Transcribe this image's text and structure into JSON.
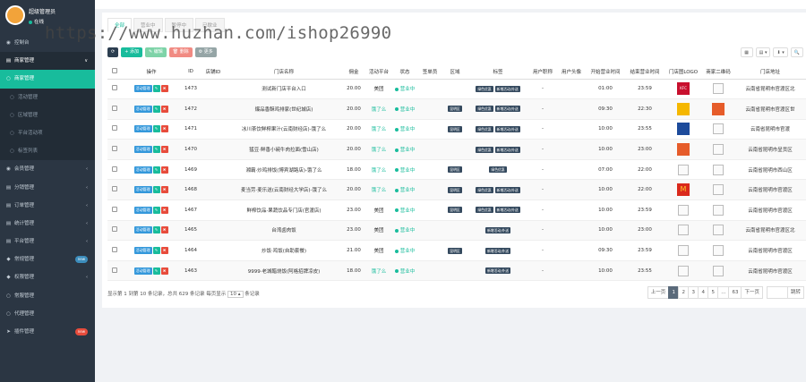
{
  "user": {
    "name": "超级管理员",
    "status": "在线"
  },
  "watermark": "https://www.huzhan.com/ishop26990",
  "topbar_hint": "",
  "sidebar": [
    {
      "icon": "◉",
      "label": "控制台",
      "type": "main",
      "badge": "",
      "arrow": ""
    },
    {
      "icon": "▤",
      "label": "商家管理",
      "type": "open",
      "badge": "",
      "arrow": "∨"
    },
    {
      "icon": "○",
      "label": "商家管理",
      "type": "active",
      "badge": "",
      "arrow": ""
    },
    {
      "icon": "○",
      "label": "活动管理",
      "type": "sub",
      "badge": "",
      "arrow": ""
    },
    {
      "icon": "○",
      "label": "区域管理",
      "type": "sub",
      "badge": "",
      "arrow": ""
    },
    {
      "icon": "○",
      "label": "平台活动项",
      "type": "sub",
      "badge": "",
      "arrow": ""
    },
    {
      "icon": "○",
      "label": "标签列表",
      "type": "sub",
      "badge": "",
      "arrow": ""
    },
    {
      "icon": "◉",
      "label": "会员管理",
      "type": "main",
      "badge": "",
      "arrow": "‹"
    },
    {
      "icon": "▤",
      "label": "分销管理",
      "type": "main",
      "badge": "",
      "arrow": "‹"
    },
    {
      "icon": "▤",
      "label": "订单管理",
      "type": "main",
      "badge": "",
      "arrow": "‹"
    },
    {
      "icon": "▤",
      "label": "统计管理",
      "type": "main",
      "badge": "",
      "arrow": "‹"
    },
    {
      "icon": "▤",
      "label": "平台管理",
      "type": "main",
      "badge": "",
      "arrow": "‹"
    },
    {
      "icon": "◆",
      "label": "常规管理",
      "type": "main",
      "badge": "new",
      "badgeColor": "#3c8dbc",
      "arrow": ""
    },
    {
      "icon": "◆",
      "label": "权限管理",
      "type": "main",
      "badge": "",
      "arrow": "‹"
    },
    {
      "icon": "○",
      "label": "常服管理",
      "type": "main",
      "badge": "",
      "arrow": ""
    },
    {
      "icon": "○",
      "label": "代理管理",
      "type": "main",
      "badge": "",
      "arrow": ""
    },
    {
      "icon": "➤",
      "label": "插件管理",
      "type": "main",
      "badge": "new",
      "badgeColor": "#e74c3c",
      "arrow": ""
    }
  ],
  "tabs": [
    "全部",
    "营业中",
    "暂停中",
    "已歇业"
  ],
  "toolbar": {
    "refresh": "⟳",
    "add": "+ 添加",
    "edit": "✎ 编辑",
    "delete": "🗑 删除",
    "more": "⚙ 更多"
  },
  "right_tools": [
    "▦",
    "▤ ▾",
    "⬇ ▾",
    "🔍"
  ],
  "columns": [
    "",
    "操作",
    "ID",
    "店铺ID",
    "门店名称",
    "佣金",
    "活动平台",
    "状态",
    "签单员",
    "区域",
    "标签",
    "用户职称",
    "用户头像",
    "开始营业时间",
    "结束营业时间",
    "门店图LOGO",
    "商家二维码",
    "门店地址"
  ],
  "op_label": "活动管理",
  "rows": [
    {
      "id": "1473",
      "shop": "",
      "name": "测试新门店平台入口",
      "fee": "20.00",
      "platform": "美团",
      "status": "营业中",
      "signer": "",
      "area": "",
      "tags": [
        "绿色优惠",
        "新增活动/外送"
      ],
      "title": "-",
      "avatar": "",
      "start": "01:00",
      "end": "23:59",
      "logo": "kfc",
      "logo_text": "KFC",
      "qr": "broken",
      "addr": "云南省昆明市官渡区北"
    },
    {
      "id": "1472",
      "shop": "",
      "name": "爆品香酥鸡排家(世纪城店)",
      "fee": "20.00",
      "platform": "饿了么",
      "status": "营业中",
      "signer": "",
      "area": "昆明区",
      "tags": [
        "绿色优惠",
        "新增活动/外送"
      ],
      "title": "-",
      "avatar": "",
      "start": "09:30",
      "end": "22:30",
      "logo": "yellow",
      "logo_text": "",
      "qr": "orange",
      "addr": "云南省昆明市官渡区世"
    },
    {
      "id": "1471",
      "shop": "",
      "name": "冰川茶饮鲜榨果汁(云南财经店)-饿了么",
      "fee": "20.00",
      "platform": "饿了么",
      "status": "营业中",
      "signer": "",
      "area": "昆明区",
      "tags": [
        "绿色优惠",
        "新增活动/外送"
      ],
      "title": "-",
      "avatar": "",
      "start": "10:00",
      "end": "23:55",
      "logo": "blue",
      "logo_text": "",
      "qr": "broken",
      "addr": "云南省昆明市官渡"
    },
    {
      "id": "1470",
      "shop": "",
      "name": "猛豆·鲜香小碗牛肉拉面(雪山店)",
      "fee": "20.00",
      "platform": "饿了么",
      "status": "营业中",
      "signer": "",
      "area": "",
      "tags": [
        "绿色优惠",
        "新增活动/外送"
      ],
      "title": "-",
      "avatar": "",
      "start": "10:00",
      "end": "23:00",
      "logo": "org",
      "logo_text": "",
      "qr": "broken",
      "addr": "云南省昆明市呈贡区"
    },
    {
      "id": "1469",
      "shop": "",
      "name": "湘霸·炒鸡排饭(博宾湖路店)-饿了么",
      "fee": "18.00",
      "platform": "饿了么",
      "status": "营业中",
      "signer": "",
      "area": "昆明区",
      "tags": [
        "绿色优惠"
      ],
      "title": "-",
      "avatar": "",
      "start": "07:00",
      "end": "22:00",
      "logo": "broken",
      "logo_text": "",
      "qr": "broken",
      "addr": "云南省昆明市西山区"
    },
    {
      "id": "1468",
      "shop": "",
      "name": "麦当劳·麦乐送(云南财经大学店)-饿了么",
      "fee": "20.00",
      "platform": "饿了么",
      "status": "营业中",
      "signer": "",
      "area": "昆明区",
      "tags": [
        "绿色优惠",
        "新增活动/外送"
      ],
      "title": "-",
      "avatar": "",
      "start": "10:00",
      "end": "22:00",
      "logo": "mcd",
      "logo_text": "M",
      "qr": "broken",
      "addr": "云南省昆明市官渡区"
    },
    {
      "id": "1467",
      "shop": "",
      "name": "鲜榨饮品·果蔬饮品专门店(官渡店)",
      "fee": "23.00",
      "platform": "美团",
      "status": "营业中",
      "signer": "",
      "area": "昆明区",
      "tags": [
        "绿色优惠",
        "新增活动/外送"
      ],
      "title": "-",
      "avatar": "",
      "start": "10:00",
      "end": "23:59",
      "logo": "broken",
      "logo_text": "",
      "qr": "broken",
      "addr": "云南省昆明市官渡区"
    },
    {
      "id": "1465",
      "shop": "",
      "name": "台湾卤肉饭",
      "fee": "23.00",
      "platform": "美团",
      "status": "营业中",
      "signer": "",
      "area": "",
      "tags": [
        "新增活动/外送"
      ],
      "title": "-",
      "avatar": "",
      "start": "10:00",
      "end": "23:00",
      "logo": "broken",
      "logo_text": "",
      "qr": "broken",
      "addr": "云南省昆明市官渡区北"
    },
    {
      "id": "1464",
      "shop": "",
      "name": "炒饭·鸡饭(自助套餐)",
      "fee": "21.00",
      "platform": "美团",
      "status": "营业中",
      "signer": "",
      "area": "昆明区",
      "tags": [
        "新增活动/外送"
      ],
      "title": "-",
      "avatar": "",
      "start": "09:30",
      "end": "23:59",
      "logo": "broken",
      "logo_text": "",
      "qr": "broken",
      "addr": "云南省昆明市官渡区"
    },
    {
      "id": "1463",
      "shop": "",
      "name": "9999·老城醋烧饭(阿格招牌凉皮)",
      "fee": "18.00",
      "platform": "饿了么",
      "status": "营业中",
      "signer": "",
      "area": "",
      "tags": [
        "新增活动/外送"
      ],
      "title": "-",
      "avatar": "",
      "start": "10:00",
      "end": "23:55",
      "logo": "broken",
      "logo_text": "",
      "qr": "broken",
      "addr": "云南省昆明市官渡区"
    }
  ],
  "pager": {
    "info": "显示第 1 到第 10 条记录，总共 629 条记录 每页显示",
    "size": "10 ▴",
    "suffix": "条记录",
    "prev": "上一页",
    "pages": [
      "1",
      "2",
      "3",
      "4",
      "5",
      "...",
      "63"
    ],
    "next": "下一页",
    "jump": "跳转"
  }
}
